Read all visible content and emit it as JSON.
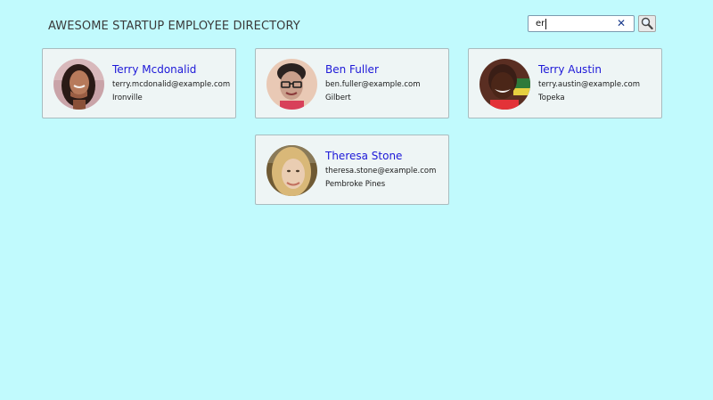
{
  "header": {
    "title": "AWESOME STARTUP EMPLOYEE DIRECTORY"
  },
  "search": {
    "value": "er",
    "clear_icon": "close-icon",
    "button_icon": "search-icon"
  },
  "employees": [
    {
      "name": "Terry Mcdonalid",
      "email": "terry.mcdonalid@example.com",
      "city": "Ironville"
    },
    {
      "name": "Ben Fuller",
      "email": "ben.fuller@example.com",
      "city": "Gilbert"
    },
    {
      "name": "Terry Austin",
      "email": "terry.austin@example.com",
      "city": "Topeka"
    },
    {
      "name": "Theresa Stone",
      "email": "theresa.stone@example.com",
      "city": "Pembroke Pines"
    }
  ],
  "colors": {
    "page_background": "#c1fafd",
    "card_background": "#eef5f5",
    "name_link": "#1d18d8"
  }
}
